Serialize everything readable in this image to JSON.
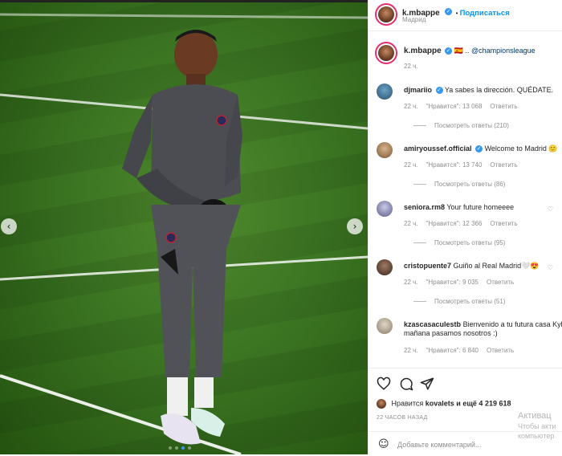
{
  "post": {
    "author": "k.mbappe",
    "follow_label": "Подписаться",
    "location": "Мадрид",
    "caption_tag": "@championsleague",
    "caption_flags": "🇪🇸 ..",
    "caption_time": "22 ч."
  },
  "photo": {
    "prev_icon": "‹",
    "next_icon": "›"
  },
  "comments": [
    {
      "user": "djmariio",
      "verified": true,
      "text": "Ya sabes la dirección. QUÉDATE.",
      "time": "22 ч.",
      "likes": "\"Нравится\": 13 068",
      "reply": "Ответить",
      "replies": "Посмотреть ответы (210)"
    },
    {
      "user": "amiryoussef.official",
      "verified": true,
      "text": "Welcome to Madrid 🙂",
      "time": "22 ч.",
      "likes": "\"Нравится\": 13 740",
      "reply": "Ответить",
      "replies": "Посмотреть ответы (86)"
    },
    {
      "user": "seniora.rm8",
      "verified": false,
      "text": "Your future homeeee",
      "time": "22 ч.",
      "likes": "\"Нравится\": 12 366",
      "reply": "Ответить",
      "replies": "Посмотреть ответы (95)"
    },
    {
      "user": "cristopuente7",
      "verified": false,
      "text": "Guiño al Real Madrid🤍😍",
      "time": "22 ч.",
      "likes": "\"Нравится\": 9 035",
      "reply": "Ответить",
      "replies": "Посмотреть ответы (51)"
    },
    {
      "user": "kzascasaculestb",
      "verified": false,
      "text": "Bienvenido a tu futura casa Kyli",
      "text2": "mañana pasamos nosotros :)",
      "time": "22 ч.",
      "likes": "\"Нравится\": 6 840",
      "reply": "Ответить"
    }
  ],
  "likes_bar": {
    "prefix": "Нравится",
    "user": "kovalets",
    "rest": "и ещё 4 219 618",
    "ago": "22 ЧАСОВ НАЗАД"
  },
  "add_comment": {
    "placeholder": "Добавьте комментарий..."
  },
  "watermark": {
    "line1": "Активац",
    "line2": "Чтобы акти",
    "line3": "компьютер"
  }
}
